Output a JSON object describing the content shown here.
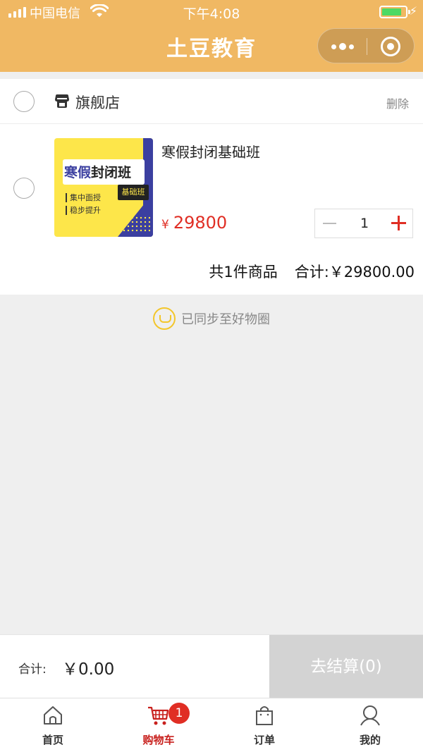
{
  "status_bar": {
    "carrier": "中国电信",
    "time": "下午4:08",
    "battery_level": 0.85
  },
  "nav": {
    "title": "土豆教育"
  },
  "shop": {
    "name": "旗舰店",
    "delete_label": "删除"
  },
  "product": {
    "title": "寒假封闭基础班",
    "price_symbol": "¥",
    "price": "29800",
    "quantity": "1",
    "image": {
      "title_main": "寒假",
      "title_rest": "封闭班",
      "tag": "基础班",
      "line1": "集中面授",
      "line2": "稳步提升"
    }
  },
  "summary": {
    "count_text": "共1件商品",
    "total_text": "合计:￥29800.00"
  },
  "sync_text": "已同步至好物圈",
  "checkout": {
    "total_label": "合计:",
    "total_value": "￥0.00",
    "settle_label": "去结算(0)"
  },
  "tabbar": {
    "items": [
      {
        "label": "首页",
        "icon": "home-icon"
      },
      {
        "label": "购物车",
        "icon": "cart-icon",
        "badge": "1",
        "active": true
      },
      {
        "label": "订单",
        "icon": "bag-icon"
      },
      {
        "label": "我的",
        "icon": "user-icon"
      }
    ]
  },
  "colors": {
    "nav_background": "#f0b863",
    "price": "#e02e24",
    "active_tab": "#c8201d",
    "settle_disabled": "#d3d3d3"
  }
}
